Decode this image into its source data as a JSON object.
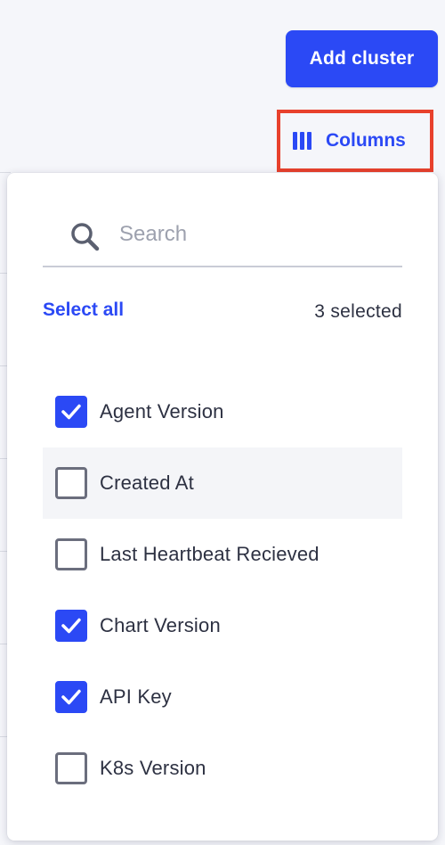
{
  "toolbar": {
    "add_cluster_label": "Add cluster",
    "columns_label": "Columns"
  },
  "columns_menu": {
    "search_placeholder": "Search",
    "search_value": "",
    "select_all_label": "Select all",
    "selected_count_text": "3 selected",
    "options": [
      {
        "label": "Agent Version",
        "checked": true
      },
      {
        "label": "Created At",
        "checked": false
      },
      {
        "label": "Last Heartbeat Recieved",
        "checked": false
      },
      {
        "label": "Chart Version",
        "checked": true
      },
      {
        "label": "API Key",
        "checked": true
      },
      {
        "label": "K8s Version",
        "checked": false
      }
    ]
  },
  "colors": {
    "accent": "#2b49f5",
    "highlight_border": "#e8412c",
    "text": "#2d3142",
    "background": "#f5f6fa"
  },
  "icons": {
    "columns": "columns-icon",
    "search": "search-icon",
    "check": "check-icon"
  }
}
